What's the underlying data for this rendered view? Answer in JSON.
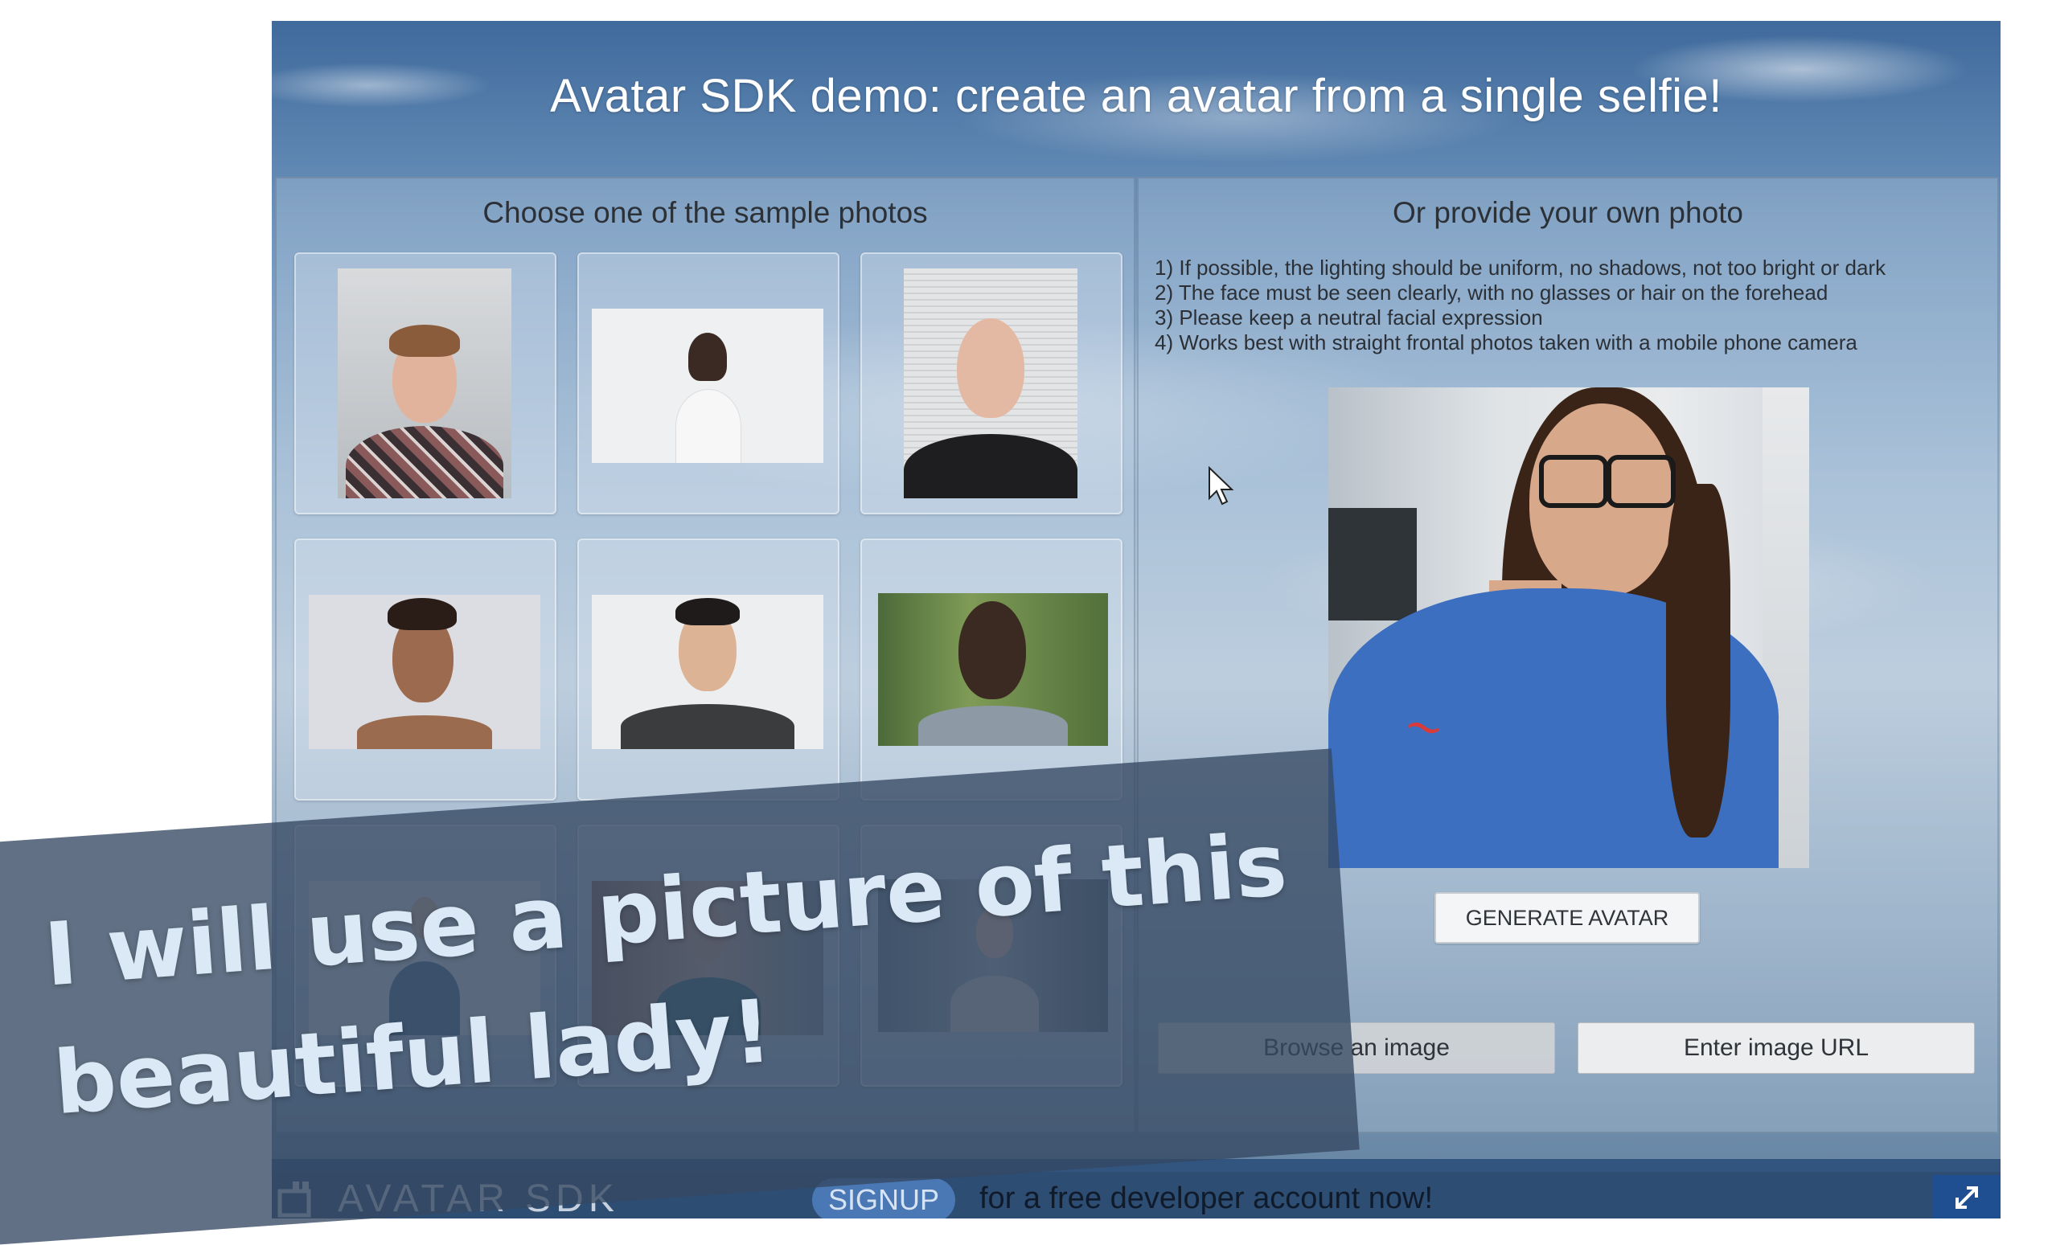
{
  "header": {
    "title": "Avatar SDK demo: create an avatar from a single selfie!"
  },
  "left_panel": {
    "heading": "Choose one of the sample photos",
    "samples": [
      "Sample photo 1",
      "Sample photo 2",
      "Sample photo 3",
      "Sample photo 4",
      "Sample photo 5",
      "Sample photo 6",
      "Sample photo 7",
      "Sample photo 8",
      "Sample photo 9"
    ]
  },
  "right_panel": {
    "heading": "Or provide your own photo",
    "rules": [
      "1) If possible, the lighting should be uniform, no shadows, not too bright or dark",
      "2) The face must be seen clearly, with no glasses or hair on the forehead",
      "3) Please keep a neutral facial expression",
      "4) Works best with straight frontal photos taken with a mobile phone camera"
    ],
    "generate_label": "GENERATE AVATAR",
    "browse_label": "Browse an image",
    "url_label": "Enter image URL"
  },
  "footer": {
    "logo_text": "AVATAR SDK",
    "signup_label": "SIGNUP",
    "signup_text": "for a free developer account now!"
  },
  "overlay": {
    "line1": "I will use a picture of this",
    "line2": "beautiful lady!"
  },
  "colors": {
    "footer": "#2e4d73",
    "signup_pill": "#4a78b4",
    "expand_button": "#1f4f91",
    "overlay_banner": "#34486a"
  },
  "icons": [
    "avatar-sdk-logo-icon",
    "expand-icon",
    "mouse-cursor-icon"
  ]
}
